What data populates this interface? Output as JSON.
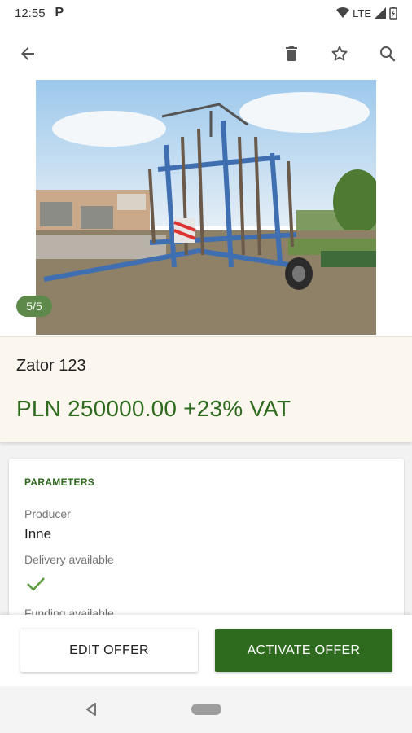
{
  "status_bar": {
    "time": "12:55",
    "app_icon": "P",
    "network": "LTE"
  },
  "app_bar": {
    "back_icon": "arrow-back-icon",
    "delete_icon": "trash-icon",
    "favorite_icon": "star-outline-icon",
    "search_icon": "search-icon"
  },
  "gallery": {
    "counter": "5/5"
  },
  "offer": {
    "title": "Zator 123",
    "price": "PLN 250000.00 +23% VAT"
  },
  "parameters": {
    "heading": "PARAMETERS",
    "producer_label": "Producer",
    "producer_value": "Inne",
    "delivery_label": "Delivery available",
    "funding_label": "Funding available"
  },
  "actions": {
    "edit_label": "EDIT OFFER",
    "activate_label": "ACTIVATE OFFER"
  },
  "colors": {
    "accent": "#2e6b1f",
    "title_bg": "#fbf7ee",
    "counter_bg": "#5d8a4a"
  }
}
